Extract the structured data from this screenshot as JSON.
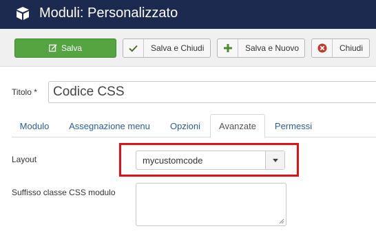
{
  "header": {
    "title": "Moduli: Personalizzato",
    "logo_icon": "cube-icon",
    "background": "#1b2a4e"
  },
  "toolbar": {
    "save_label": "Salva",
    "save_close_label": "Salva e Chiudi",
    "save_new_label": "Salva e Nuovo",
    "close_label": "Chiudi",
    "save_color": "#54a542"
  },
  "form": {
    "title_label": "Titolo *",
    "title_value": "Codice CSS"
  },
  "tabs": [
    {
      "label": "Modulo",
      "active": false
    },
    {
      "label": "Assegnazione menu",
      "active": false
    },
    {
      "label": "Opzioni",
      "active": false
    },
    {
      "label": "Avanzate",
      "active": true
    },
    {
      "label": "Permessi",
      "active": false
    }
  ],
  "advanced": {
    "layout_label": "Layout",
    "layout_value": "mycustomcode",
    "suffix_label": "Suffisso classe CSS modulo",
    "suffix_value": "",
    "highlight_color": "#e20e18"
  }
}
